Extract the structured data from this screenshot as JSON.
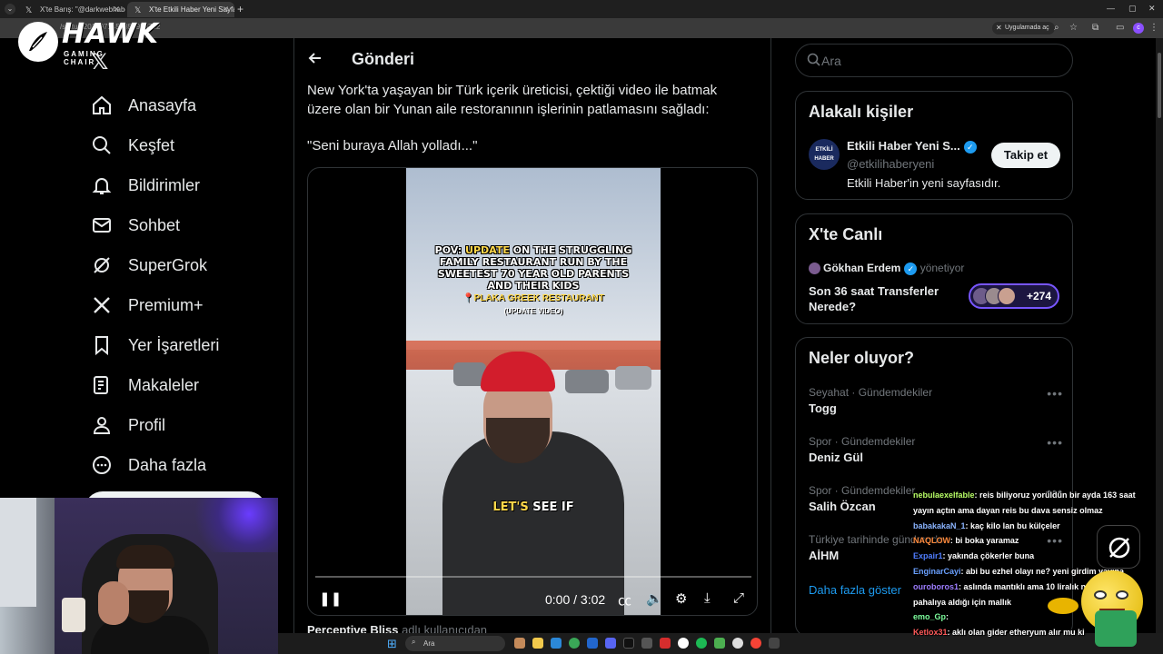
{
  "browser": {
    "tabs": [
      {
        "label": "X'te Barış: \"@darkwebhaber Bu"
      },
      {
        "label": "X'te Etkili Haber Yeni Sayfa: \"Ne"
      }
    ],
    "url": "/status/2018971454855958722",
    "app_button": "Uygulamada aç"
  },
  "overlay": {
    "brand": "HAWK",
    "brand_sub": "GAMING CHAIR"
  },
  "nav": {
    "items": [
      {
        "label": "Anasayfa",
        "icon": "home-icon"
      },
      {
        "label": "Keşfet",
        "icon": "search-icon"
      },
      {
        "label": "Bildirimler",
        "icon": "bell-icon"
      },
      {
        "label": "Sohbet",
        "icon": "mail-icon"
      },
      {
        "label": "SuperGrok",
        "icon": "grok-icon"
      },
      {
        "label": "Premium+",
        "icon": "x-icon"
      },
      {
        "label": "Yer İşaretleri",
        "icon": "bookmark-icon"
      },
      {
        "label": "Makaleler",
        "icon": "article-icon"
      },
      {
        "label": "Profil",
        "icon": "person-icon"
      },
      {
        "label": "Daha fazla",
        "icon": "more-icon"
      }
    ]
  },
  "post": {
    "header_title": "Gönderi",
    "text": "New York'ta yaşayan bir Türk içerik üreticisi, çektiği video ile batmak üzere olan bir Yunan aile restoranının işlerinin patlamasını sağladı:",
    "quote": "\"Seni buraya Allah yolladı...\"",
    "video": {
      "caption_pov": "POV:",
      "caption_update": "UPDATE",
      "caption_rest": "ON THE STRUGGLING FAMILY RESTAURANT RUN BY THE SWEETEST 70 YEAR OLD PARENTS AND THEIR KIDS",
      "place": "📍PLAKA GREEK RESTAURANT",
      "update_tag": "(UPDATE VIDEO)",
      "subtitle_a": "LET'S",
      "subtitle_b": "SEE IF",
      "time": "0:00 / 3:02",
      "progress": 0.0
    },
    "next_author": "Perceptive Bliss",
    "next_author_suffix": "adlı kullanıcıdan"
  },
  "search": {
    "placeholder": "Ara"
  },
  "related": {
    "title": "Alakalı kişiler",
    "person": {
      "avatar_text": "ETKİLİ HABER",
      "name": "Etkili Haber Yeni S...",
      "handle": "@etkilihaberyeni",
      "bio": "Etkili Haber'in yeni sayfasıdır.",
      "follow_label": "Takip et"
    }
  },
  "live": {
    "title": "X'te Canlı",
    "host": "Gökhan Erdem",
    "role": "yönetiyor",
    "space_title": "Son 36 saat Transferler Nerede?",
    "listener_count": "+274"
  },
  "trends": {
    "title": "Neler oluyor?",
    "items": [
      {
        "meta": "Seyahat · Gündemdekiler",
        "name": "Togg"
      },
      {
        "meta": "Spor · Gündemdekiler",
        "name": "Deniz Gül"
      },
      {
        "meta": "Spor · Gündemdekiler",
        "name": "Salih Özcan"
      },
      {
        "meta": "Türkiye tarihinde gündemde",
        "name": "AİHM"
      }
    ],
    "show_more": "Daha fazla göster"
  },
  "chat": [
    {
      "user": "nebulaexelfable",
      "color": "#b9ff66",
      "msg": ": reis biliyoruz yorüldün bir ayda 163 saat yayın açtın ama dayan reis bu dava sensiz olmaz"
    },
    {
      "user": "babakakaN_1",
      "color": "#8ab4ff",
      "msg": ": kaç kilo lan bu külçeler"
    },
    {
      "user": "NAQLOW",
      "color": "#ff8a3d",
      "msg": ": bi boka yaramaz"
    },
    {
      "user": "Expair1",
      "color": "#4f7dff",
      "msg": ": yakında çökerler buna"
    },
    {
      "user": "EnginarCayi",
      "color": "#6aa0ff",
      "msg": ": abi bu ezhel olayı ne? yeni girdim yayına"
    },
    {
      "user": "ouroboros1",
      "color": "#9d7dff",
      "msg": ": aslında mantıklı ama 10 liralık nesnelere pahalıya aldığı için mallık"
    },
    {
      "user": "emo_Gp",
      "color": "#7dff9d",
      "msg": ":"
    },
    {
      "user": "Ketlox31",
      "color": "#ff5a5a",
      "msg": ": aklı olan gider etheryum alır mu ki"
    }
  ],
  "taskbar": {
    "search_placeholder": "Ara"
  },
  "colors": {
    "accent": "#1d9bf0",
    "background": "#000000",
    "border": "#2f3336",
    "text": "#e7e9ea",
    "muted": "#71767b"
  }
}
